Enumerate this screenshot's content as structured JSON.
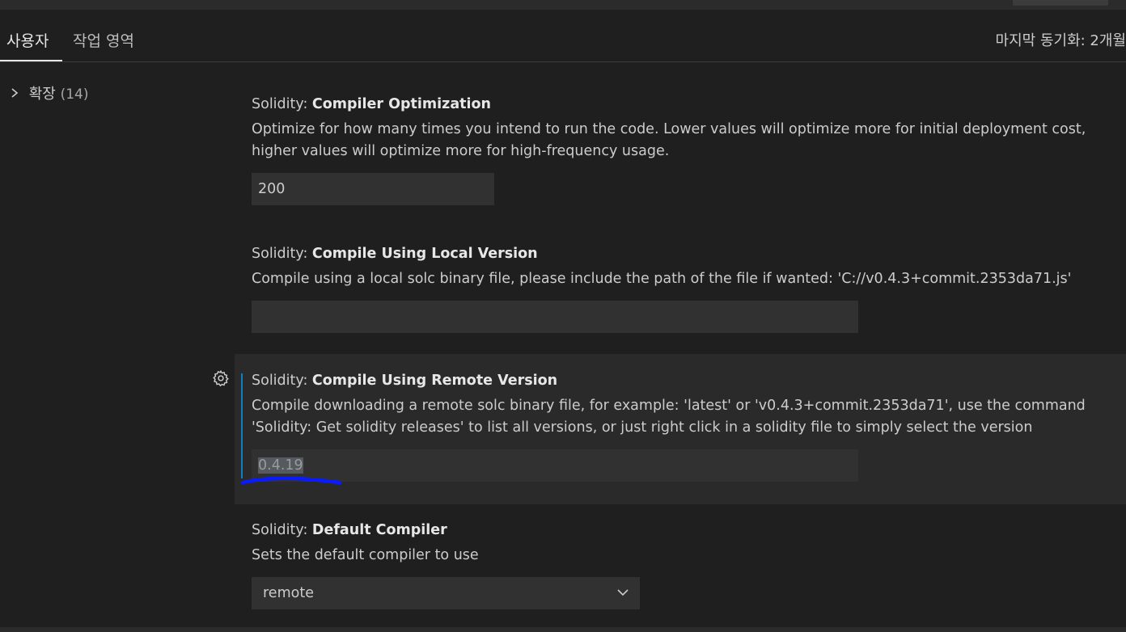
{
  "tabs": {
    "user": "사용자",
    "workspace": "작업 영역"
  },
  "last_sync": "마지막 동기화: 2개월",
  "toc": {
    "label": "확장",
    "count": "(14)"
  },
  "settings": [
    {
      "category": "Solidity: ",
      "name": "Compiler Optimization",
      "description": "Optimize for how many times you intend to run the code. Lower values will optimize more for initial deployment cost, higher values will optimize more for high-frequency usage.",
      "value": "200"
    },
    {
      "category": "Solidity: ",
      "name": "Compile Using Local Version",
      "description": "Compile using a local solc binary file, please include the path of the file if wanted: 'C://v0.4.3+commit.2353da71.js'",
      "value": ""
    },
    {
      "category": "Solidity: ",
      "name": "Compile Using Remote Version",
      "description": "Compile downloading a remote solc binary file, for example: 'latest' or 'v0.4.3+commit.2353da71', use the command 'Solidity: Get solidity releases' to list all versions, or just right click in a solidity file to simply select the version",
      "value": "0.4.19"
    },
    {
      "category": "Solidity: ",
      "name": "Default Compiler",
      "description": "Sets the default compiler to use",
      "value": "remote"
    }
  ],
  "colors": {
    "focus_accent": "#0e7ec7",
    "annotation_blue": "#0a1cff"
  }
}
